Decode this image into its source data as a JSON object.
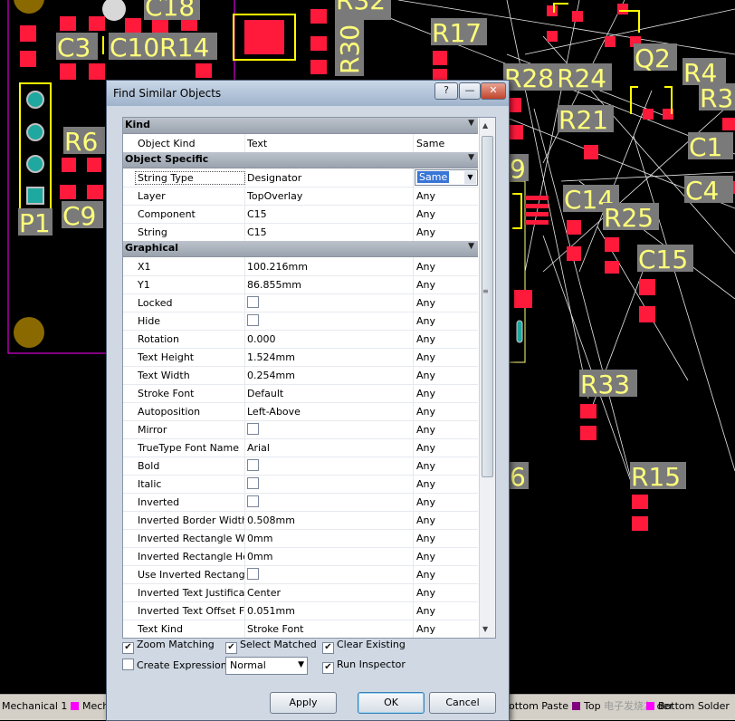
{
  "pcb": {
    "labels": [
      "C18",
      "R32",
      "C3",
      "C10R14",
      "R30",
      "R17",
      "R24",
      "R28",
      "Q2",
      "R4",
      "R3",
      "R6",
      "R21",
      "C1",
      "C9",
      "C4",
      "P1",
      "C14",
      "R25",
      "C15",
      "R33",
      "6",
      "R15",
      "9"
    ]
  },
  "dialog": {
    "title": "Find Similar Objects",
    "title_buttons": {
      "help": "?",
      "minimize": "—",
      "close": "✕"
    },
    "categories": {
      "kind": "Kind",
      "object_specific": "Object Specific",
      "graphical": "Graphical"
    },
    "rows": {
      "object_kind": {
        "label": "Object Kind",
        "value": "Text",
        "mode": "Same"
      },
      "string_type": {
        "label": "String Type",
        "value": "Designator",
        "mode": "Same"
      },
      "layer": {
        "label": "Layer",
        "value": "TopOverlay",
        "mode": "Any"
      },
      "component": {
        "label": "Component",
        "value": "C15",
        "mode": "Any"
      },
      "string": {
        "label": "String",
        "value": "C15",
        "mode": "Any"
      },
      "x1": {
        "label": "X1",
        "value": "100.216mm",
        "mode": "Any"
      },
      "y1": {
        "label": "Y1",
        "value": "86.855mm",
        "mode": "Any"
      },
      "locked": {
        "label": "Locked",
        "mode": "Any"
      },
      "hide": {
        "label": "Hide",
        "mode": "Any"
      },
      "rotation": {
        "label": "Rotation",
        "value": "0.000",
        "mode": "Any"
      },
      "text_height": {
        "label": "Text Height",
        "value": "1.524mm",
        "mode": "Any"
      },
      "text_width": {
        "label": "Text Width",
        "value": "0.254mm",
        "mode": "Any"
      },
      "stroke_font": {
        "label": "Stroke Font",
        "value": "Default",
        "mode": "Any"
      },
      "autoposition": {
        "label": "Autoposition",
        "value": "Left-Above",
        "mode": "Any"
      },
      "mirror": {
        "label": "Mirror",
        "mode": "Any"
      },
      "truetype_font_name": {
        "label": "TrueType Font Name",
        "value": "Arial",
        "mode": "Any"
      },
      "bold": {
        "label": "Bold",
        "mode": "Any"
      },
      "italic": {
        "label": "Italic",
        "mode": "Any"
      },
      "inverted": {
        "label": "Inverted",
        "mode": "Any"
      },
      "inverted_border_width": {
        "label": "Inverted Border Width",
        "value": "0.508mm",
        "mode": "Any"
      },
      "inverted_rectangle_width": {
        "label": "Inverted Rectangle Wic",
        "value": "0mm",
        "mode": "Any"
      },
      "inverted_rectangle_height": {
        "label": "Inverted Rectangle Hei",
        "value": "0mm",
        "mode": "Any"
      },
      "use_inverted_rectangle": {
        "label": "Use Inverted Rectangle",
        "mode": "Any"
      },
      "inverted_text_justification": {
        "label": "Inverted Text Justificati",
        "value": "Center",
        "mode": "Any"
      },
      "inverted_text_offset": {
        "label": "Inverted Text Offset Fro",
        "value": "0.051mm",
        "mode": "Any"
      },
      "text_kind": {
        "label": "Text Kind",
        "value": "Stroke Font",
        "mode": "Any"
      }
    },
    "options": {
      "zoom_matching": {
        "label": "Zoom Matching",
        "checked": true
      },
      "select_matched": {
        "label": "Select Matched",
        "checked": true
      },
      "clear_existing": {
        "label": "Clear Existing",
        "checked": true
      },
      "create_expression": {
        "label": "Create Expression",
        "checked": false
      },
      "run_inspector": {
        "label": "Run Inspector",
        "checked": true
      },
      "mode_select": "Normal"
    },
    "buttons": {
      "apply": "Apply",
      "ok": "OK",
      "cancel": "Cancel"
    }
  },
  "layer_tabs": {
    "mechanical1": "Mechanical 1",
    "mech": "Mech",
    "bottom_paste": "ottom Paste",
    "top_solder": "Top",
    "top_solder_tail": "der",
    "bottom_solder": "Bottom Solder",
    "colors": {
      "magenta": "#ff00ff",
      "purple": "#800080"
    }
  },
  "watermark": "电子发烧友"
}
